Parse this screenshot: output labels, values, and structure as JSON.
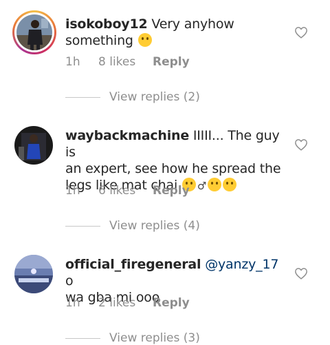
{
  "comments": [
    {
      "username": "isokoboy12",
      "text_line1": " Very anyhow",
      "text_line2": "something ",
      "time": "1h",
      "likes": "8 likes",
      "reply_label": "Reply",
      "view_replies": "View replies (2)",
      "has_story": true
    },
    {
      "username": "waybackmachine",
      "text_line1": " IIIII... The guy is",
      "text_line2": "an expert, see how he spread the",
      "text_line3": "legs like mat chai ",
      "gender_symbol": "♂",
      "time": "1h",
      "likes": "6 likes",
      "reply_label": "Reply",
      "view_replies": "View replies (4)"
    },
    {
      "username": "official_firegeneral",
      "mention": "@yanzy_17",
      "text_line1": " o",
      "text_line2": "wa gba mi ooo",
      "time": "1h",
      "likes": "2 likes",
      "reply_label": "Reply",
      "view_replies": "View replies (3)"
    }
  ],
  "icons": {
    "like": "heart-outline-icon",
    "emoji_smile": "slightly-smiling-face",
    "emoji_scream": "screaming-face",
    "emoji_laugh": "face-with-tears-of-joy"
  },
  "colors": {
    "text": "#262626",
    "secondary": "#8e8e8e",
    "mention": "#003569",
    "divider": "#c7c7c7"
  }
}
